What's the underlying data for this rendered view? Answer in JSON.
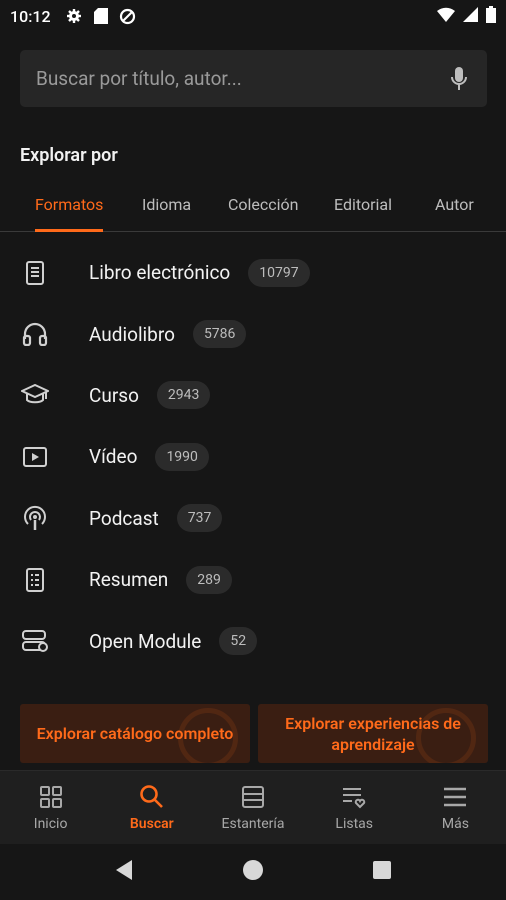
{
  "status_bar": {
    "time": "10:12",
    "icons": [
      "gear-icon",
      "sd-card-icon",
      "data-saver-icon",
      "wifi-icon",
      "signal-icon",
      "battery-icon"
    ]
  },
  "search": {
    "placeholder": "Buscar por título, autor..."
  },
  "section_title": "Explorar por",
  "tabs": [
    {
      "label": "Formatos",
      "active": true
    },
    {
      "label": "Idioma",
      "active": false
    },
    {
      "label": "Colección",
      "active": false
    },
    {
      "label": "Editorial",
      "active": false
    },
    {
      "label": "Autor",
      "active": false
    }
  ],
  "formats": [
    {
      "label": "Libro electrónico",
      "count": "10797",
      "icon": "ebook-icon"
    },
    {
      "label": "Audiolibro",
      "count": "5786",
      "icon": "headphones-icon"
    },
    {
      "label": "Curso",
      "count": "2943",
      "icon": "graduation-cap-icon"
    },
    {
      "label": "Vídeo",
      "count": "1990",
      "icon": "video-icon"
    },
    {
      "label": "Podcast",
      "count": "737",
      "icon": "podcast-icon"
    },
    {
      "label": "Resumen",
      "count": "289",
      "icon": "summary-icon"
    },
    {
      "label": "Open Module",
      "count": "52",
      "icon": "module-icon"
    }
  ],
  "cta": {
    "catalog": "Explorar catálogo completo",
    "experiences": "Explorar experiencias de aprendizaje"
  },
  "bottom_nav": [
    {
      "label": "Inicio",
      "icon": "grid-icon",
      "active": false
    },
    {
      "label": "Buscar",
      "icon": "search-icon",
      "active": true
    },
    {
      "label": "Estantería",
      "icon": "shelf-icon",
      "active": false
    },
    {
      "label": "Listas",
      "icon": "list-heart-icon",
      "active": false
    },
    {
      "label": "Más",
      "icon": "menu-icon",
      "active": false
    }
  ],
  "colors": {
    "accent": "#ff6a1a",
    "background": "#161616",
    "surface": "#262626"
  }
}
